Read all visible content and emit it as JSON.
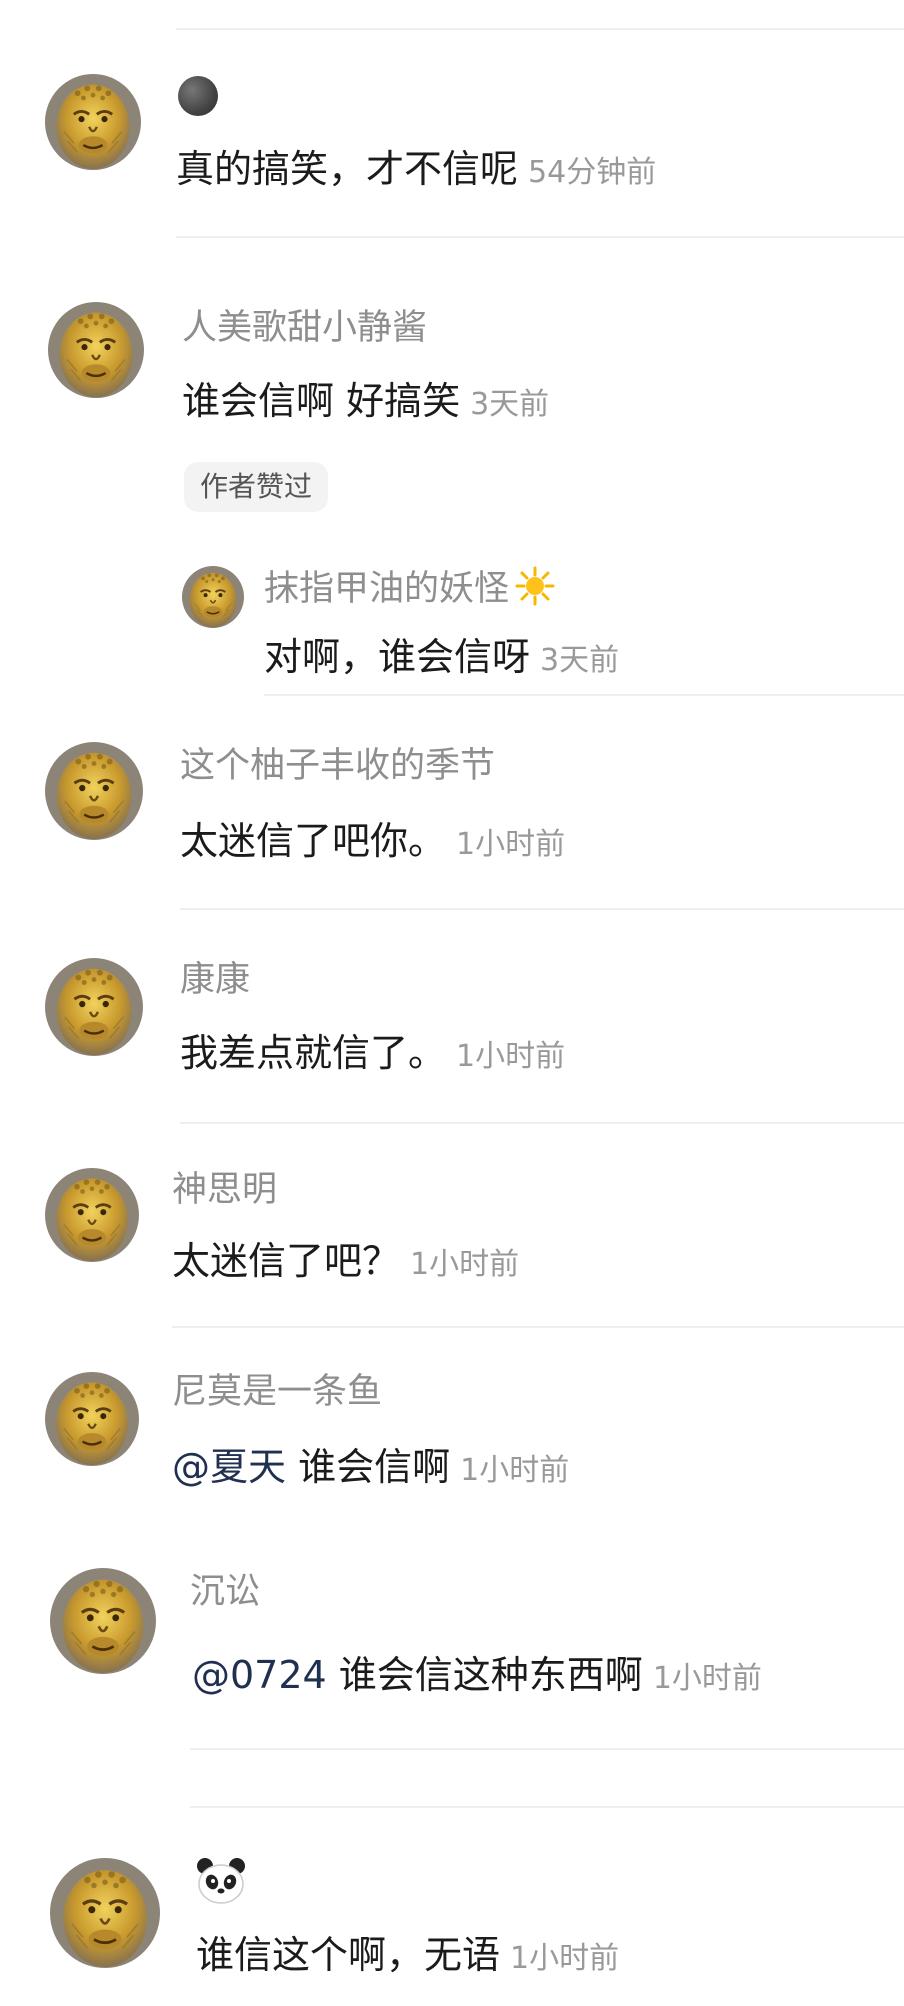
{
  "comments": [
    {
      "username": "",
      "username_icon": "dark-sphere-icon",
      "text": "真的搞笑，才不信呢",
      "time": "54分钟前"
    },
    {
      "username": "人美歌甜小静酱",
      "text": "谁会信啊 好搞笑",
      "time": "3天前",
      "badge": "作者赞过",
      "reply": {
        "username": "抹指甲油的妖怪",
        "username_icon": "sun-icon",
        "text": "对啊，谁会信呀",
        "time": "3天前"
      }
    },
    {
      "username": "这个柚子丰收的季节",
      "text": "太迷信了吧你。",
      "time": "1小时前"
    },
    {
      "username": "康康",
      "text": "我差点就信了。",
      "time": "1小时前"
    },
    {
      "username": "神思明",
      "text": "太迷信了吧？",
      "time": "1小时前"
    },
    {
      "username": "尼莫是一条鱼",
      "mention": "@夏天",
      "text": " 谁会信啊",
      "time": "1小时前"
    },
    {
      "username": "沉讼",
      "mention": "@0724",
      "text": " 谁会信这种东西啊",
      "time": "1小时前"
    },
    {
      "username": "",
      "username_icon": "panda-icon",
      "text": "谁信这个啊，无语",
      "time": "1小时前"
    }
  ],
  "avatar_icon": "golden-monkey-king-avatar",
  "colors": {
    "username": "#8e8e8e",
    "text": "#1b1b1b",
    "time": "#999999",
    "mention": "#203050",
    "badge_bg": "#f3f3f3"
  }
}
